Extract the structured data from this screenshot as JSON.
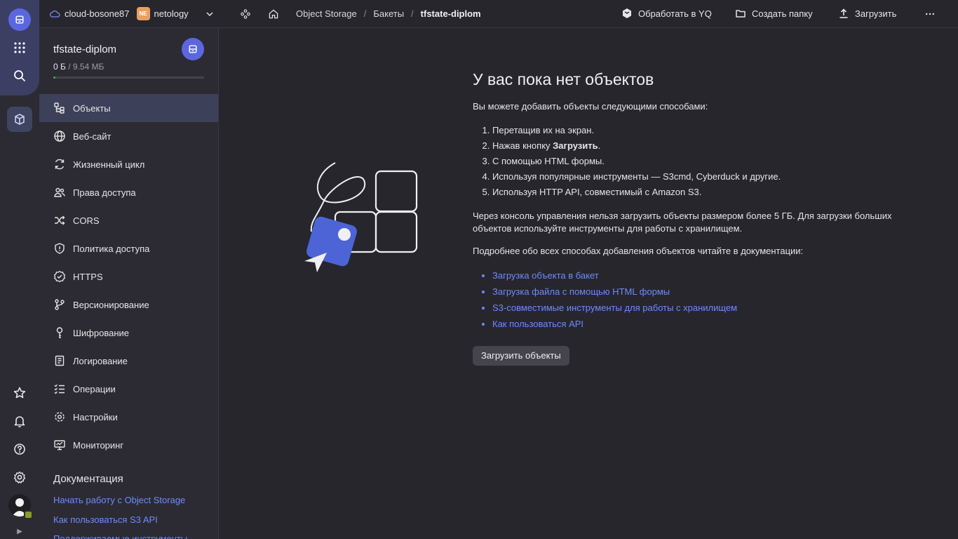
{
  "rail": {
    "logo_icon": "object-storage-icon",
    "items": [
      "services-grid-icon",
      "search-icon",
      "storage-box-icon"
    ],
    "bottom_items": [
      "star-icon",
      "bell-icon",
      "help-icon",
      "gear-icon"
    ]
  },
  "header": {
    "cloud_name": "cloud-bosone87",
    "folder_badge": "NE",
    "folder_name": "netology",
    "breadcrumbs": [
      "Object Storage",
      "Бакеты",
      "tfstate-diplom"
    ],
    "actions": {
      "yq": "Обработать в YQ",
      "create_folder": "Создать папку",
      "upload": "Загрузить"
    }
  },
  "sidebar": {
    "bucket_name": "tfstate-diplom",
    "used": "0 Б",
    "capacity": "/ 9.54 МБ",
    "usage_fraction": 0.01,
    "items": [
      {
        "label": "Объекты",
        "icon": "objects-icon"
      },
      {
        "label": "Веб-сайт",
        "icon": "globe-icon"
      },
      {
        "label": "Жизненный цикл",
        "icon": "lifecycle-icon"
      },
      {
        "label": "Права доступа",
        "icon": "users-icon"
      },
      {
        "label": "CORS",
        "icon": "shuffle-icon"
      },
      {
        "label": "Политика доступа",
        "icon": "shield-icon"
      },
      {
        "label": "HTTPS",
        "icon": "badge-check-icon"
      },
      {
        "label": "Версионирование",
        "icon": "branch-icon"
      },
      {
        "label": "Шифрование",
        "icon": "key-icon"
      },
      {
        "label": "Логирование",
        "icon": "log-icon"
      },
      {
        "label": "Операции",
        "icon": "list-check-icon"
      },
      {
        "label": "Настройки",
        "icon": "gear-icon"
      },
      {
        "label": "Мониторинг",
        "icon": "monitor-icon"
      }
    ],
    "docs_title": "Документация",
    "doc_links": [
      "Начать работу с Object Storage",
      "Как пользоваться S3 API",
      "Поддерживаемые инструменты"
    ]
  },
  "main": {
    "title": "У вас пока нет объектов",
    "intro": "Вы можете добавить объекты следующими способами:",
    "steps": [
      "Перетащив их на экран.",
      "Нажав кнопку Загрузить.",
      "С помощью HTML формы.",
      "Используя популярные инструменты — S3cmd, Cyberduck и другие.",
      "Используя HTTP API, совместимый с Amazon S3."
    ],
    "limit_note": "Через консоль управления нельзя загрузить объекты размером более 5 ГБ. Для загрузки больших объектов используйте инструменты для работы с хранилищем.",
    "docs_note": "Подробнее обо всех способах добавления объектов читайте в документации:",
    "links": [
      "Загрузка объекта в бакет",
      "Загрузка файла с помощью HTML формы",
      "S3-совместимые инструменты для работы с хранилищем",
      "Как пользоваться API"
    ],
    "upload_button": "Загрузить объекты"
  },
  "colors": {
    "accent": "#5b67e0",
    "link": "#6e8bff",
    "background": "#27262c",
    "sidebar": "#2c2b33"
  }
}
